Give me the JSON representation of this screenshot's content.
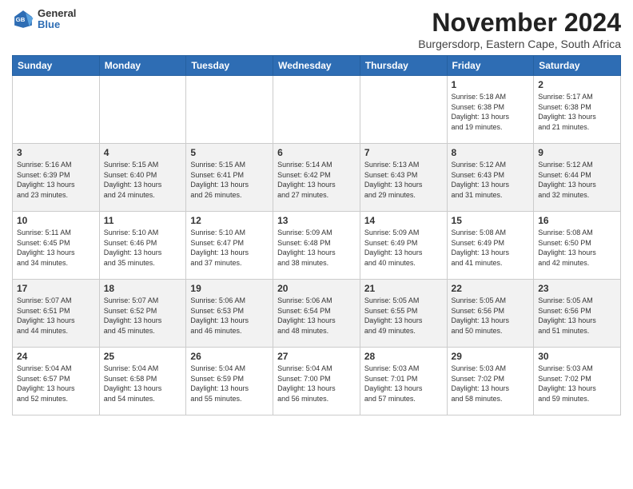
{
  "header": {
    "logo": {
      "general": "General",
      "blue": "Blue"
    },
    "title": "November 2024",
    "subtitle": "Burgersdorp, Eastern Cape, South Africa"
  },
  "days_of_week": [
    "Sunday",
    "Monday",
    "Tuesday",
    "Wednesday",
    "Thursday",
    "Friday",
    "Saturday"
  ],
  "weeks": [
    [
      {
        "day": "",
        "info": ""
      },
      {
        "day": "",
        "info": ""
      },
      {
        "day": "",
        "info": ""
      },
      {
        "day": "",
        "info": ""
      },
      {
        "day": "",
        "info": ""
      },
      {
        "day": "1",
        "info": "Sunrise: 5:18 AM\nSunset: 6:38 PM\nDaylight: 13 hours\nand 19 minutes."
      },
      {
        "day": "2",
        "info": "Sunrise: 5:17 AM\nSunset: 6:38 PM\nDaylight: 13 hours\nand 21 minutes."
      }
    ],
    [
      {
        "day": "3",
        "info": "Sunrise: 5:16 AM\nSunset: 6:39 PM\nDaylight: 13 hours\nand 23 minutes."
      },
      {
        "day": "4",
        "info": "Sunrise: 5:15 AM\nSunset: 6:40 PM\nDaylight: 13 hours\nand 24 minutes."
      },
      {
        "day": "5",
        "info": "Sunrise: 5:15 AM\nSunset: 6:41 PM\nDaylight: 13 hours\nand 26 minutes."
      },
      {
        "day": "6",
        "info": "Sunrise: 5:14 AM\nSunset: 6:42 PM\nDaylight: 13 hours\nand 27 minutes."
      },
      {
        "day": "7",
        "info": "Sunrise: 5:13 AM\nSunset: 6:43 PM\nDaylight: 13 hours\nand 29 minutes."
      },
      {
        "day": "8",
        "info": "Sunrise: 5:12 AM\nSunset: 6:43 PM\nDaylight: 13 hours\nand 31 minutes."
      },
      {
        "day": "9",
        "info": "Sunrise: 5:12 AM\nSunset: 6:44 PM\nDaylight: 13 hours\nand 32 minutes."
      }
    ],
    [
      {
        "day": "10",
        "info": "Sunrise: 5:11 AM\nSunset: 6:45 PM\nDaylight: 13 hours\nand 34 minutes."
      },
      {
        "day": "11",
        "info": "Sunrise: 5:10 AM\nSunset: 6:46 PM\nDaylight: 13 hours\nand 35 minutes."
      },
      {
        "day": "12",
        "info": "Sunrise: 5:10 AM\nSunset: 6:47 PM\nDaylight: 13 hours\nand 37 minutes."
      },
      {
        "day": "13",
        "info": "Sunrise: 5:09 AM\nSunset: 6:48 PM\nDaylight: 13 hours\nand 38 minutes."
      },
      {
        "day": "14",
        "info": "Sunrise: 5:09 AM\nSunset: 6:49 PM\nDaylight: 13 hours\nand 40 minutes."
      },
      {
        "day": "15",
        "info": "Sunrise: 5:08 AM\nSunset: 6:49 PM\nDaylight: 13 hours\nand 41 minutes."
      },
      {
        "day": "16",
        "info": "Sunrise: 5:08 AM\nSunset: 6:50 PM\nDaylight: 13 hours\nand 42 minutes."
      }
    ],
    [
      {
        "day": "17",
        "info": "Sunrise: 5:07 AM\nSunset: 6:51 PM\nDaylight: 13 hours\nand 44 minutes."
      },
      {
        "day": "18",
        "info": "Sunrise: 5:07 AM\nSunset: 6:52 PM\nDaylight: 13 hours\nand 45 minutes."
      },
      {
        "day": "19",
        "info": "Sunrise: 5:06 AM\nSunset: 6:53 PM\nDaylight: 13 hours\nand 46 minutes."
      },
      {
        "day": "20",
        "info": "Sunrise: 5:06 AM\nSunset: 6:54 PM\nDaylight: 13 hours\nand 48 minutes."
      },
      {
        "day": "21",
        "info": "Sunrise: 5:05 AM\nSunset: 6:55 PM\nDaylight: 13 hours\nand 49 minutes."
      },
      {
        "day": "22",
        "info": "Sunrise: 5:05 AM\nSunset: 6:56 PM\nDaylight: 13 hours\nand 50 minutes."
      },
      {
        "day": "23",
        "info": "Sunrise: 5:05 AM\nSunset: 6:56 PM\nDaylight: 13 hours\nand 51 minutes."
      }
    ],
    [
      {
        "day": "24",
        "info": "Sunrise: 5:04 AM\nSunset: 6:57 PM\nDaylight: 13 hours\nand 52 minutes."
      },
      {
        "day": "25",
        "info": "Sunrise: 5:04 AM\nSunset: 6:58 PM\nDaylight: 13 hours\nand 54 minutes."
      },
      {
        "day": "26",
        "info": "Sunrise: 5:04 AM\nSunset: 6:59 PM\nDaylight: 13 hours\nand 55 minutes."
      },
      {
        "day": "27",
        "info": "Sunrise: 5:04 AM\nSunset: 7:00 PM\nDaylight: 13 hours\nand 56 minutes."
      },
      {
        "day": "28",
        "info": "Sunrise: 5:03 AM\nSunset: 7:01 PM\nDaylight: 13 hours\nand 57 minutes."
      },
      {
        "day": "29",
        "info": "Sunrise: 5:03 AM\nSunset: 7:02 PM\nDaylight: 13 hours\nand 58 minutes."
      },
      {
        "day": "30",
        "info": "Sunrise: 5:03 AM\nSunset: 7:02 PM\nDaylight: 13 hours\nand 59 minutes."
      }
    ]
  ]
}
